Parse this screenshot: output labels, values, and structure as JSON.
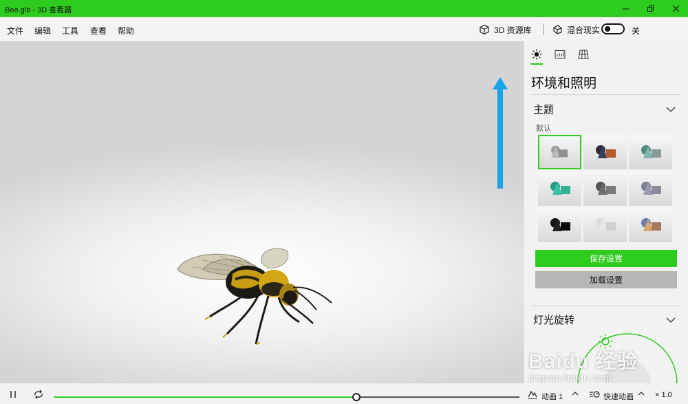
{
  "window": {
    "title": "Bee.glb - 3D 查看器"
  },
  "menu": {
    "items": [
      "文件",
      "编辑",
      "工具",
      "查看",
      "帮助"
    ],
    "library_label": "3D 资源库",
    "mixed_reality_label": "混合现实",
    "mixed_reality_state": "关"
  },
  "panel": {
    "heading": "环境和照明",
    "theme_section": "主题",
    "theme_default_label": "默认",
    "save_button": "保存设置",
    "load_button": "加载设置",
    "light_section": "灯光旋转"
  },
  "watermark": {
    "line1": "Baidu 经验",
    "line2": "jingyan.baidu.com"
  },
  "playback": {
    "progress": 0.65,
    "animation_label": "动画 1",
    "fast_animation_label": "快速动画",
    "speed_label": "× 1.0"
  },
  "colors": {
    "accent": "#2ecc1f",
    "arrow": "#1aa3e8"
  }
}
